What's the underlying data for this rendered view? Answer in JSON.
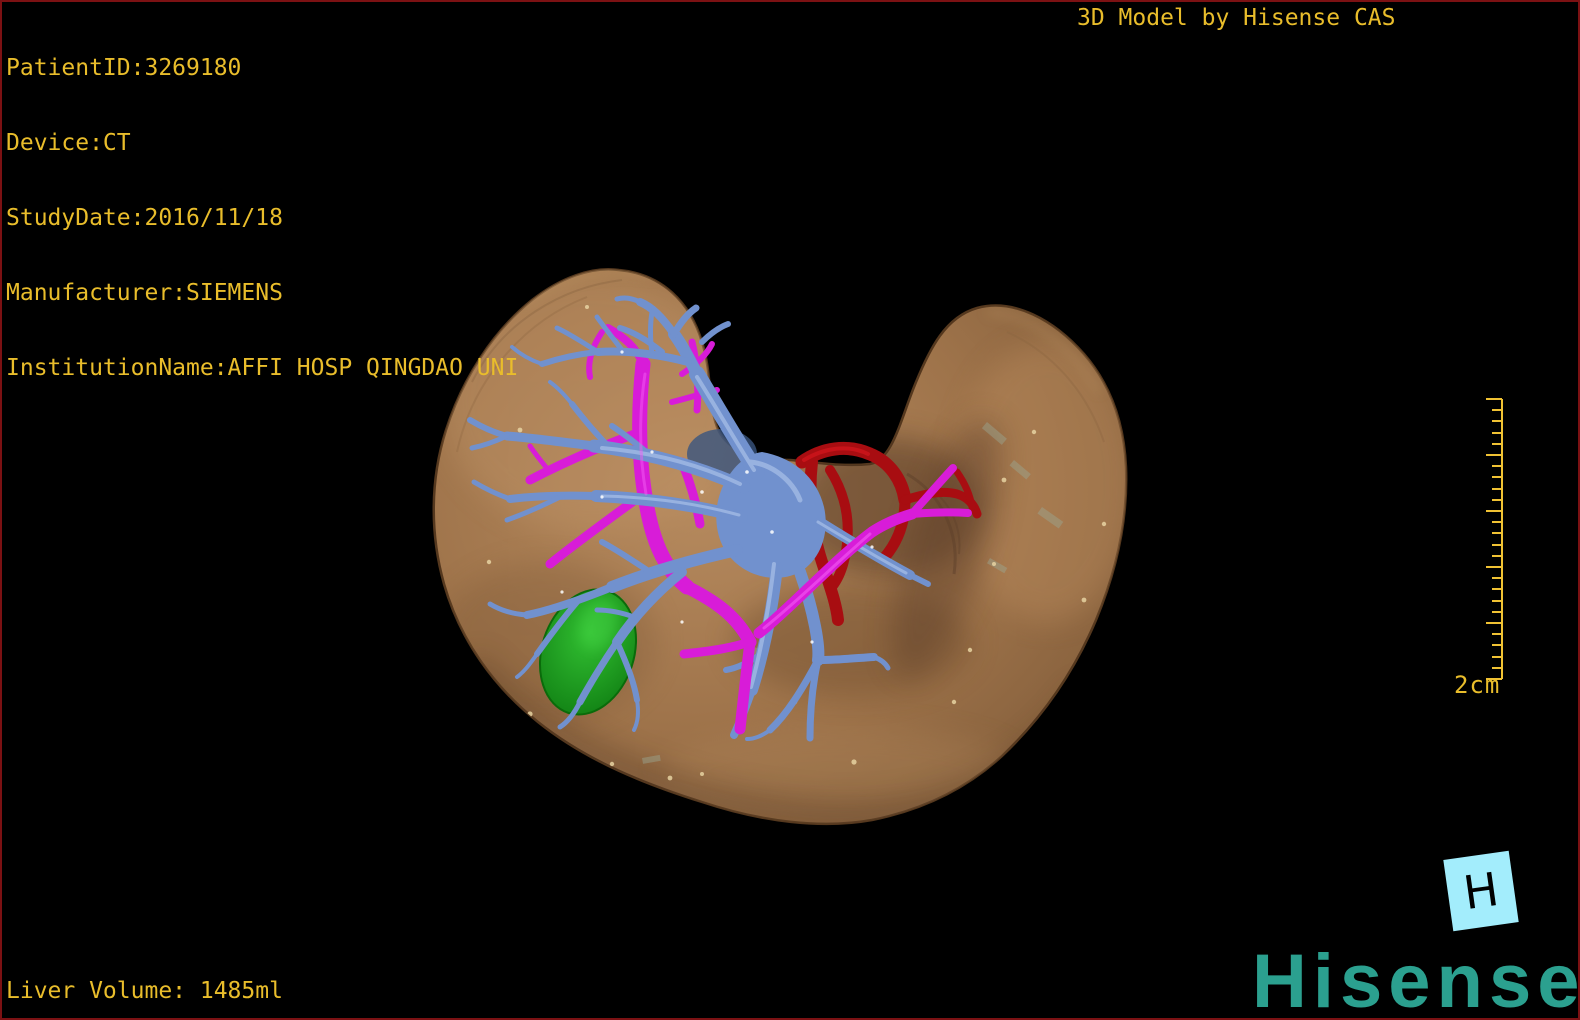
{
  "header": {
    "patient_info": [
      "PatientID:3269180",
      "Device:CT",
      "StudyDate:2016/11/18",
      "Manufacturer:SIEMENS",
      "InstitutionName:AFFI HOSP QINGDAO UNI"
    ],
    "watermark": "3D Model by Hisense CAS"
  },
  "footer": {
    "liver_volume": "Liver Volume: 1485ml",
    "brand": "Hisense"
  },
  "scale_bar": {
    "label": "2cm"
  },
  "orientation": {
    "label": "H"
  },
  "colors": {
    "overlay_text": "#e9bd2b",
    "border": "#7c1113",
    "background": "#000000",
    "brand_teal": "#2ba08f",
    "orientation_marker_bg": "#a3edfc",
    "liver_parenchyma": "#a87e55",
    "portal_vein_blue": "#7191ce",
    "hepatic_vein_magenta": "#d81cd8",
    "artery_red": "#a80d11",
    "gallbladder_green": "#189e18"
  }
}
